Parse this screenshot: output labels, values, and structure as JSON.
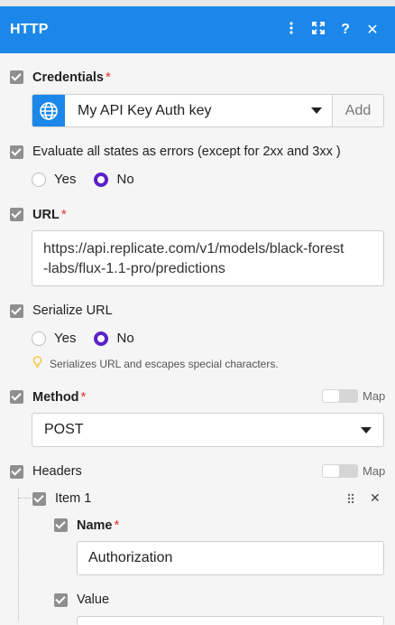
{
  "header": {
    "title": "HTTP",
    "icons": [
      "more-vertical-icon",
      "expand-icon",
      "help-icon",
      "close-icon"
    ]
  },
  "credentials": {
    "label": "Credentials",
    "value": "My API Key Auth key",
    "add_label": "Add"
  },
  "evaluate": {
    "label": "Evaluate all states as errors (except for 2xx and 3xx )",
    "options": [
      "Yes",
      "No"
    ],
    "selected": "No"
  },
  "url": {
    "label": "URL",
    "value": "https://api.replicate.com/v1/models/black-forest-labs/flux-1.1-pro/predictions",
    "line1": "https://api.replicate.com/v1/models/black-forest",
    "line2": "-labs/flux-1.1-pro/predictions"
  },
  "serialize": {
    "label": "Serialize URL",
    "options": [
      "Yes",
      "No"
    ],
    "selected": "No",
    "hint": "Serializes URL and escapes special characters."
  },
  "method": {
    "label": "Method",
    "map_label": "Map",
    "value": "POST"
  },
  "headers": {
    "label": "Headers",
    "map_label": "Map",
    "items": [
      {
        "title": "Item 1",
        "name_label": "Name",
        "name_value": "Authorization",
        "value_label": "Value"
      }
    ]
  },
  "colors": {
    "accent": "#1a87e9",
    "radio_selected": "#5b21c9",
    "required": "#e03131"
  }
}
